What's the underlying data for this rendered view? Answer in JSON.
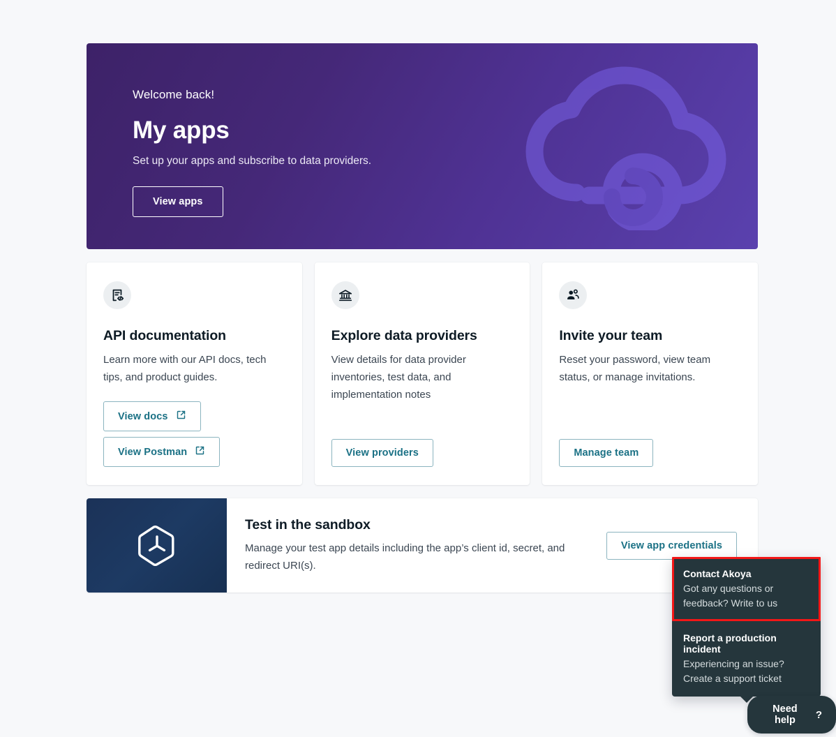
{
  "hero": {
    "welcome": "Welcome back!",
    "title": "My apps",
    "subtitle": "Set up your apps and subscribe to data providers.",
    "button_label": "View apps",
    "graphic": "cloud-icon",
    "gradient_from": "#3d2268",
    "gradient_to": "#5a41ae"
  },
  "cards": [
    {
      "icon": "api-doc-code-icon",
      "title": "API documentation",
      "description": "Learn more with our API docs, tech tips, and product guides.",
      "buttons": [
        {
          "label": "View docs",
          "icon": "external-link-icon"
        },
        {
          "label": "View Postman",
          "icon": "external-link-icon"
        }
      ]
    },
    {
      "icon": "bank-institution-icon",
      "title": "Explore data providers",
      "description": "View details for data provider inventories, test data, and implementation notes",
      "buttons": [
        {
          "label": "View providers",
          "icon": ""
        }
      ]
    },
    {
      "icon": "team-users-icon",
      "title": "Invite your team",
      "description": "Reset your password, view team status, or manage invitations.",
      "buttons": [
        {
          "label": "Manage team",
          "icon": ""
        }
      ]
    }
  ],
  "sandbox": {
    "logo": "akoya-hexagon-logo",
    "title": "Test in the sandbox",
    "description": "Manage your test app details including the app’s client id, secret, and redirect URI(s).",
    "button_label": "View app credentials"
  },
  "help": {
    "button_label": "Need help",
    "button_icon": "question-mark-icon",
    "highlight_color": "#f31717",
    "items": [
      {
        "title": "Contact Akoya",
        "description": "Got any questions or feedback? Write to us",
        "highlighted": true
      },
      {
        "title": "Report a production incident",
        "description": "Experiencing an issue? Create a support ticket",
        "highlighted": false
      }
    ]
  },
  "theme": {
    "page_background": "#f7f8fa",
    "accent_teal": "#1b7185",
    "dark_slate": "#25363c",
    "navy": "#1b3258"
  }
}
